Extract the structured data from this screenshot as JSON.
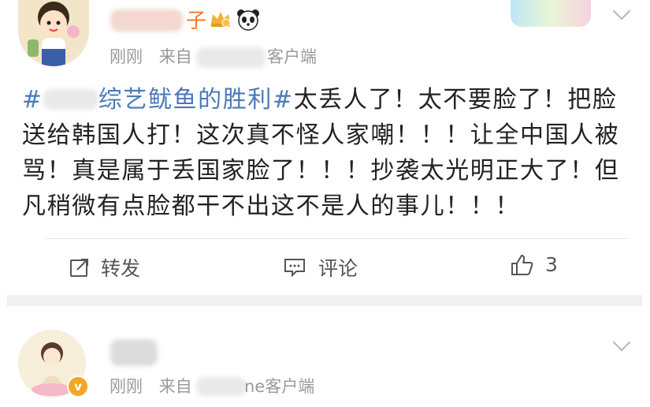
{
  "post1": {
    "author_suffix": "子",
    "time": "刚刚",
    "from_prefix": "来自",
    "client_suffix": "客户端",
    "topic_mark_open": "#",
    "topic_text": "综艺鱿鱼的胜利",
    "topic_mark_close": "#",
    "body": "太丢人了！太不要脸了！把脸送给韩国人打！这次真不怪人家嘲！！！让全中国人被骂！真是属于丢国家脸了！！！抄袭太光明正大了！但凡稍微有点脸都干不出这不是人的事儿！！！",
    "actions": {
      "repost_label": "转发",
      "comment_label": "评论",
      "like_count": "3"
    }
  },
  "post2": {
    "time": "刚刚",
    "from_prefix": "来自",
    "client_suffix": "ne客户端",
    "verified_mark": "v"
  },
  "icons": [
    "crown-icon",
    "panda-icon",
    "chevron-down-icon",
    "repost-icon",
    "comment-icon",
    "like-icon",
    "verified-icon"
  ],
  "colors": {
    "username": "#f07a2a",
    "topic": "#4a7ab8",
    "meta": "#9a9a9a",
    "verified": "#f5a623"
  }
}
